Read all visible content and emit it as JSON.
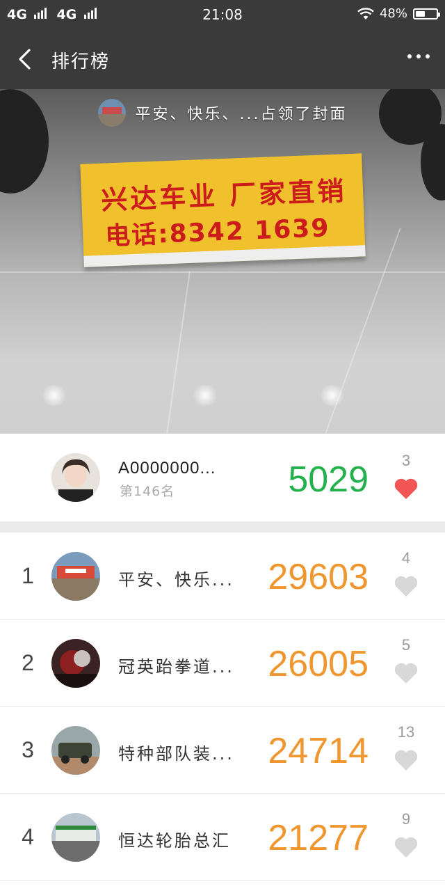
{
  "status_bar": {
    "carrier1": "4G",
    "carrier2": "4G",
    "time": "21:08",
    "battery": "48%",
    "battery_level": 0.48
  },
  "nav": {
    "title": "排行榜"
  },
  "cover": {
    "caption": "平安、快乐、...占领了封面",
    "sign_line1": "兴达车业  厂家直销",
    "sign_line2": "电话:8342 1639"
  },
  "me": {
    "name": "A0000000...",
    "rank_text": "第146名",
    "score": "5029",
    "likes": "3",
    "liked": true
  },
  "ranking": [
    {
      "rank": "1",
      "name": "平安、快乐...",
      "score": "29603",
      "likes": "4"
    },
    {
      "rank": "2",
      "name": "冠英跆拳道...",
      "score": "26005",
      "likes": "5"
    },
    {
      "rank": "3",
      "name": "特种部队装...",
      "score": "24714",
      "likes": "13"
    },
    {
      "rank": "4",
      "name": "恒达轮胎总汇",
      "score": "21277",
      "likes": "9"
    }
  ],
  "colors": {
    "bar_bg": "#3a3a3a",
    "my_score": "#22b14c",
    "rank_score": "#f0962e",
    "heart_active": "#f25555",
    "heart_inactive": "#d8d8d8"
  }
}
